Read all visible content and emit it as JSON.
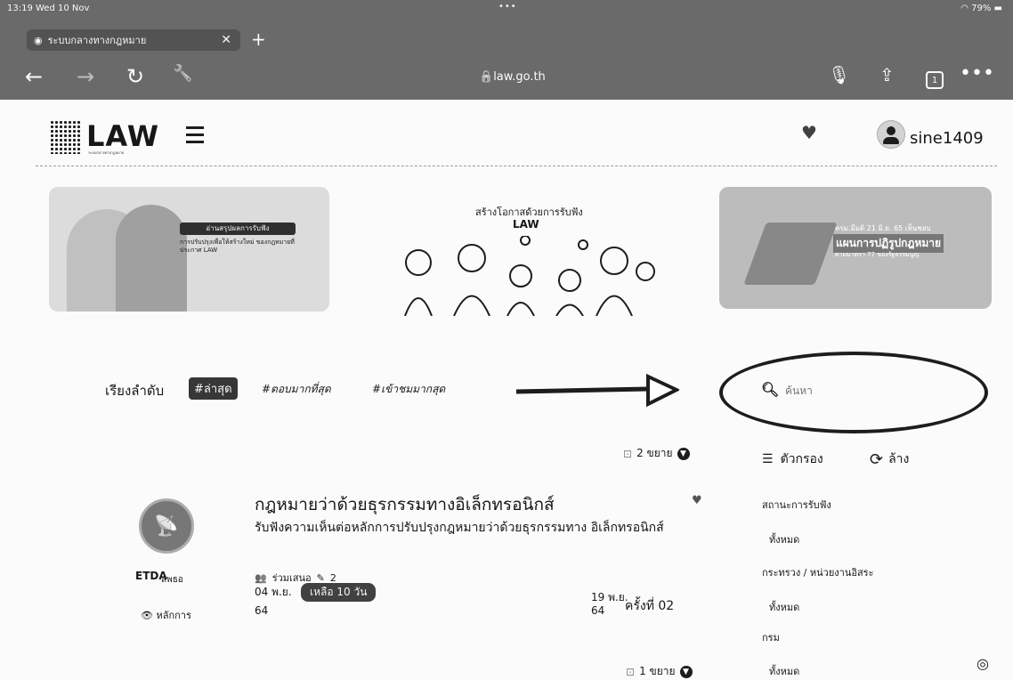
{
  "status_bar": {
    "time_date": "13:19  Wed 10 Nov",
    "battery": "79%"
  },
  "browser": {
    "tab_title": "ระบบกลางทางกฎหมาย",
    "url": "law.go.th"
  },
  "header": {
    "logo_text": "LAW",
    "logo_subtext": "ระบบกลางทางกฎหมาย",
    "username": "sine1409"
  },
  "banners": {
    "b1": {
      "tag": "อ่านสรุปผลการรับฟัง",
      "text": "การปรับปรุงเพื่อให้สร้างใหม่ ของกฎหมายที่ประกาศ LAW"
    },
    "b2": {
      "title": "สร้างโอกาสด้วยการรับฟัง",
      "sub": "LAW"
    },
    "b3": {
      "t1": "ครม.มีมติ 21 มิ.ย. 65 เห็นชอบ",
      "t2": "แผนการปฏิรูปกฎหมาย",
      "t3": "ตามมาตรา 77 ของรัฐธรรมนูญ"
    }
  },
  "sort": {
    "label": "เรียงลำดับ",
    "active": "#ล่าสุด",
    "option2": "#ตอบมากที่สุด",
    "option3": "#เข้าชมมากสุด"
  },
  "search": {
    "placeholder": "ค้นหา"
  },
  "list_controls": {
    "expand_top": "2 ขยาย",
    "filter": "ตัวกรอง",
    "clear": "ล้าง"
  },
  "filters": [
    {
      "label": "สถานะการรับฟัง",
      "value": "ทั้งหมด"
    },
    {
      "label": "กระทรวง / หน่วยงานอิสระ",
      "value": "ทั้งหมด"
    },
    {
      "label": "กรม",
      "value": "ทั้งหมด"
    }
  ],
  "law_card": {
    "title": "กฎหมายว่าด้วยธุรกรรมทางอิเล็กทรอนิกส์",
    "description": "รับฟังความเห็นต่อหลักการปรับปรุงกฎหมายว่าด้วยธุรกรรมทาง อิเล็กทรอนิกส์",
    "org_logo": "ETDA",
    "org_name": "สพธอ",
    "principle": "หลักการ",
    "participants_label": "ร่วมเสนอ",
    "participants_count": "2",
    "start_date": "04 พ.ย.",
    "start_year": "64",
    "remaining": "เหลือ 10 วัน",
    "end_date": "19 พ.ย.",
    "end_year": "64",
    "round": "ครั้งที่  02"
  },
  "expand_bottom": "1 ขยาย"
}
